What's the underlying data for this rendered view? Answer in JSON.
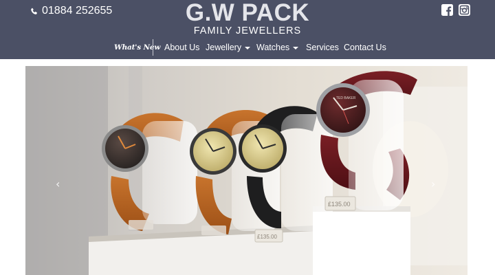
{
  "header": {
    "phone": "01884 252655",
    "brand_name": "G.W PACK",
    "brand_tagline": "FAMILY JEWELLERS",
    "background_color": "#4b5065",
    "social_icons": [
      "facebook-icon",
      "instagram-icon"
    ]
  },
  "nav": {
    "items": [
      {
        "label": "What's New",
        "dropdown": false
      },
      {
        "label": "About Us",
        "dropdown": false
      },
      {
        "label": "Jewellery",
        "dropdown": true
      },
      {
        "label": "Watches",
        "dropdown": true
      },
      {
        "label": "Services",
        "dropdown": false
      },
      {
        "label": "Contact Us",
        "dropdown": false
      }
    ]
  },
  "carousel": {
    "prev_icon": "chevron-left-icon",
    "next_icon": "chevron-right-icon",
    "prev_glyph": "‹",
    "next_glyph": "›",
    "slide": {
      "price_tags": [
        "£135.00",
        "£135.00"
      ],
      "dial_brand": "TED BAKER"
    }
  }
}
